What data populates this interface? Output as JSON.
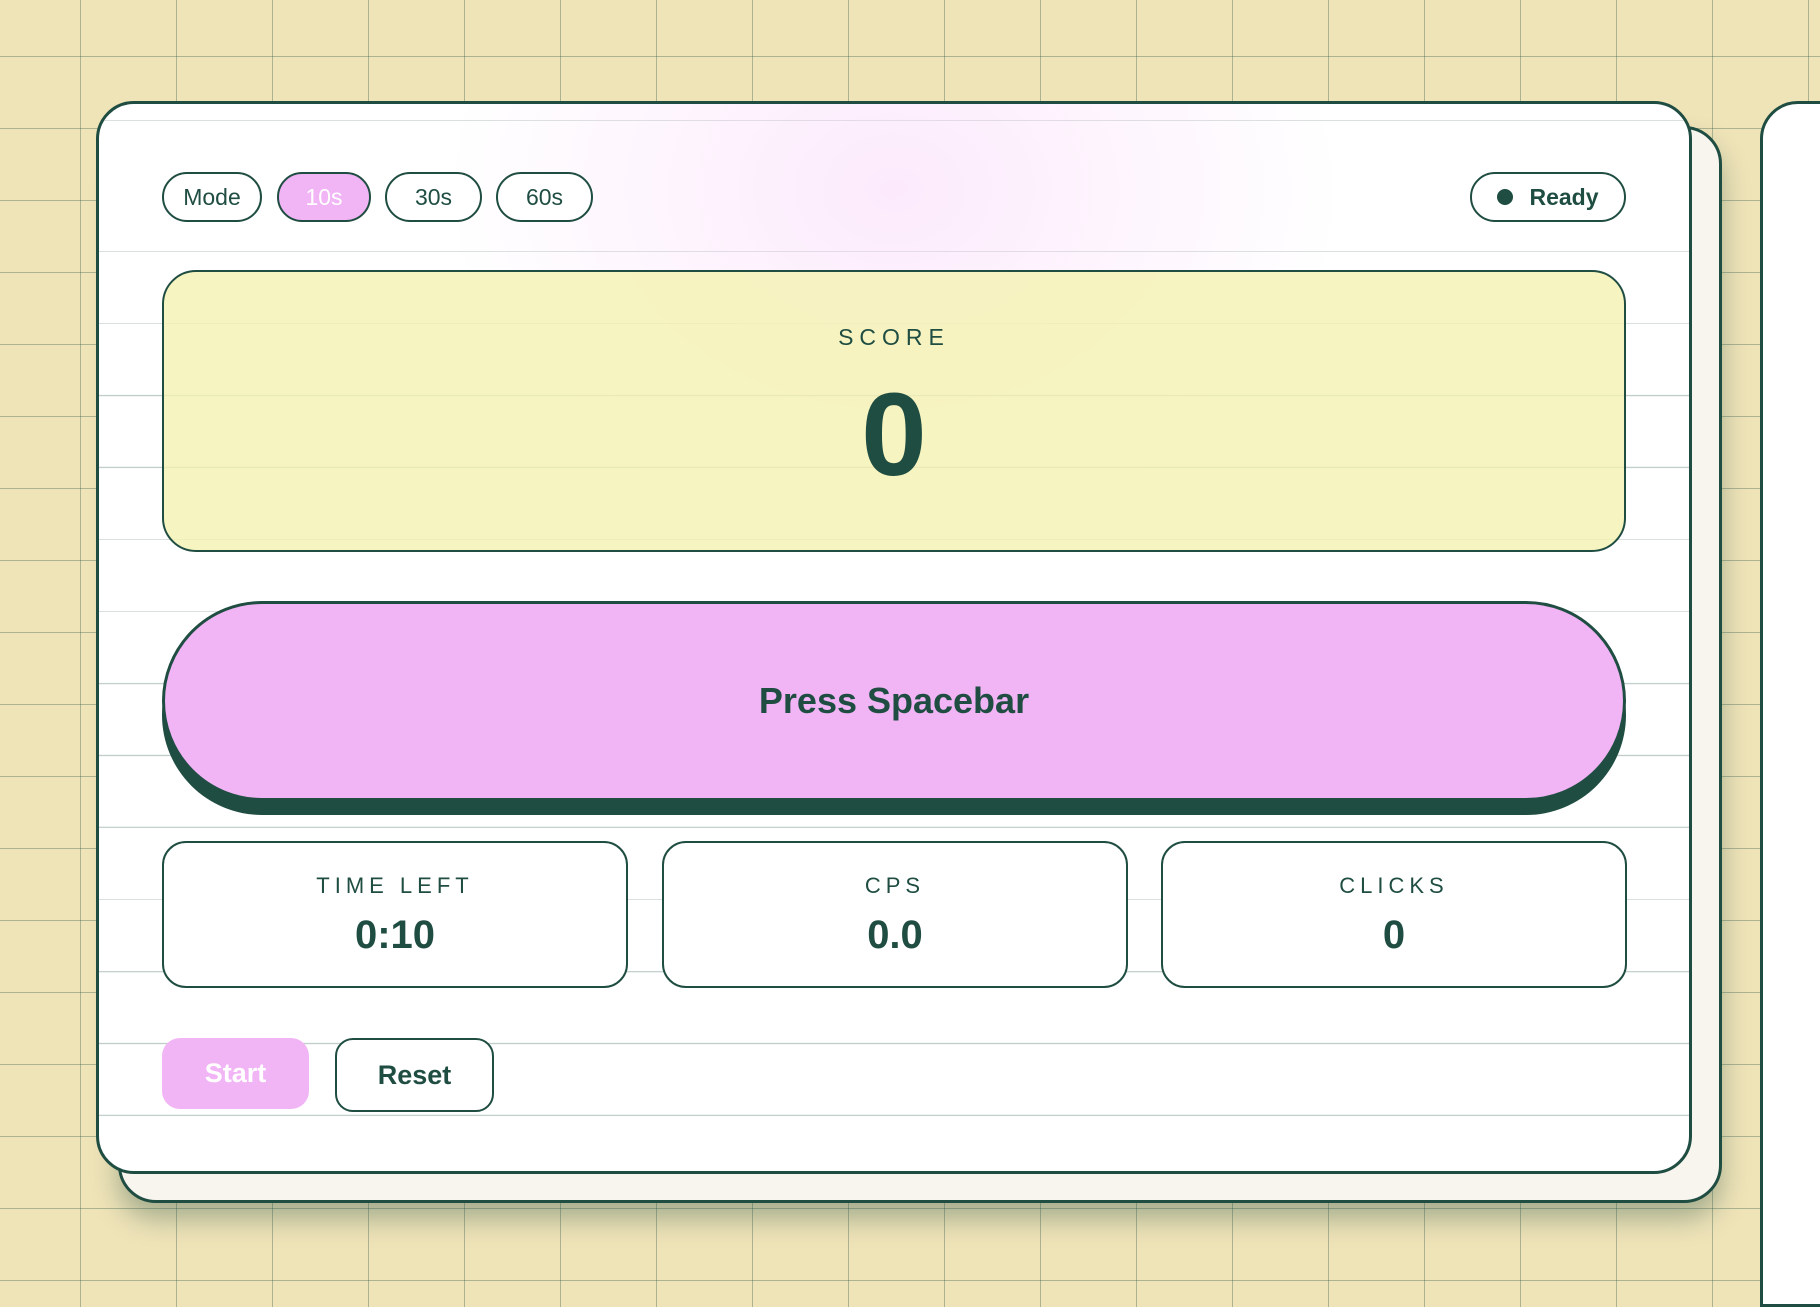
{
  "mode": {
    "label": "Mode",
    "options": [
      "10s",
      "30s",
      "60s"
    ],
    "selected": "10s"
  },
  "status": {
    "label": "Ready",
    "icon": "status-dot-icon"
  },
  "score": {
    "label": "SCORE",
    "value": "0"
  },
  "action": {
    "label": "Press Spacebar"
  },
  "stats": {
    "time_left": {
      "label": "TIME LEFT",
      "value": "0:10"
    },
    "cps": {
      "label": "CPS",
      "value": "0.0"
    },
    "clicks": {
      "label": "CLICKS",
      "value": "0"
    }
  },
  "controls": {
    "start_label": "Start",
    "reset_label": "Reset"
  },
  "colors": {
    "accent": "#f1b4f5",
    "ink": "#1f4d42",
    "score_panel": "#f4f2b0",
    "page_background": "#efe3b8"
  }
}
